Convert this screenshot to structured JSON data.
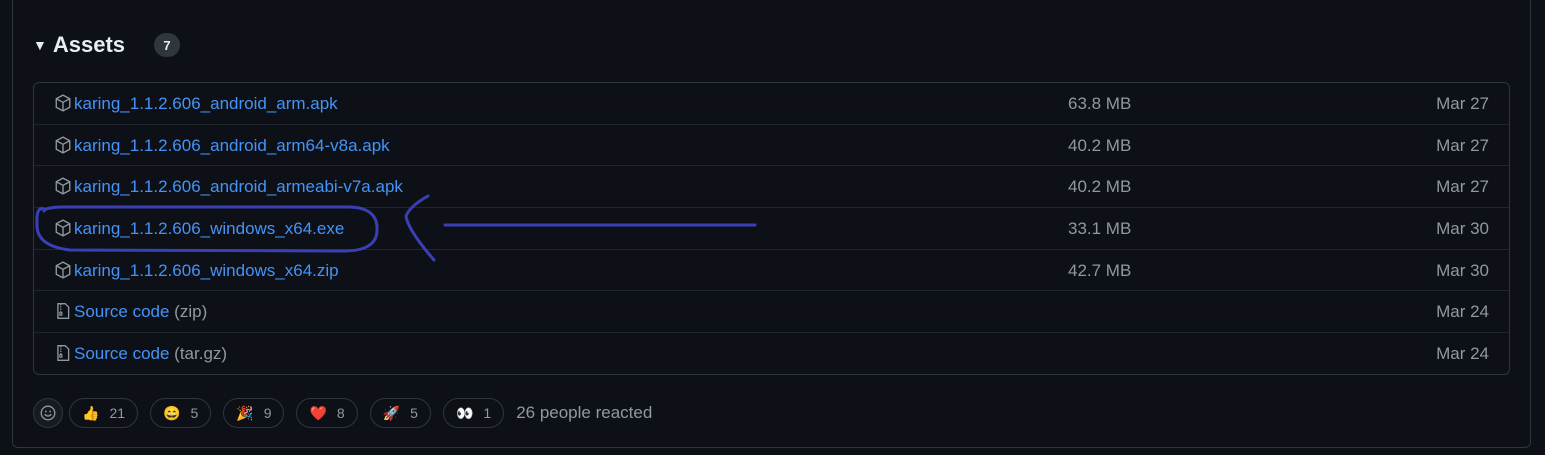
{
  "assets": {
    "title": "Assets",
    "count": "7",
    "items": [
      {
        "name": "karing_1.1.2.606_android_arm.apk",
        "suffix": "",
        "size": "63.8 MB",
        "date": "Mar 27",
        "icon": "package-icon"
      },
      {
        "name": "karing_1.1.2.606_android_arm64-v8a.apk",
        "suffix": "",
        "size": "40.2 MB",
        "date": "Mar 27",
        "icon": "package-icon"
      },
      {
        "name": "karing_1.1.2.606_android_armeabi-v7a.apk",
        "suffix": "",
        "size": "40.2 MB",
        "date": "Mar 27",
        "icon": "package-icon"
      },
      {
        "name": "karing_1.1.2.606_windows_x64.exe",
        "suffix": "",
        "size": "33.1 MB",
        "date": "Mar 30",
        "icon": "package-icon"
      },
      {
        "name": "karing_1.1.2.606_windows_x64.zip",
        "suffix": "",
        "size": "42.7 MB",
        "date": "Mar 30",
        "icon": "package-icon"
      },
      {
        "name": "Source code",
        "suffix": " (zip)",
        "size": "",
        "date": "Mar 24",
        "icon": "file-zip-icon"
      },
      {
        "name": "Source code",
        "suffix": " (tar.gz)",
        "size": "",
        "date": "Mar 24",
        "icon": "file-zip-icon"
      }
    ]
  },
  "reactions": {
    "items": [
      {
        "emoji": "👍",
        "count": "21",
        "name": "thumbs-up"
      },
      {
        "emoji": "😄",
        "count": "5",
        "name": "laugh"
      },
      {
        "emoji": "🎉",
        "count": "9",
        "name": "hooray"
      },
      {
        "emoji": "❤️",
        "count": "8",
        "name": "heart"
      },
      {
        "emoji": "🚀",
        "count": "5",
        "name": "rocket"
      },
      {
        "emoji": "👀",
        "count": "1",
        "name": "eyes"
      }
    ],
    "summary": "26 people reacted"
  },
  "colors": {
    "background": "#0d1117",
    "border": "#30363d",
    "link": "#4493f8",
    "muted": "#9198a1",
    "annotation": "#3b3fb6"
  }
}
